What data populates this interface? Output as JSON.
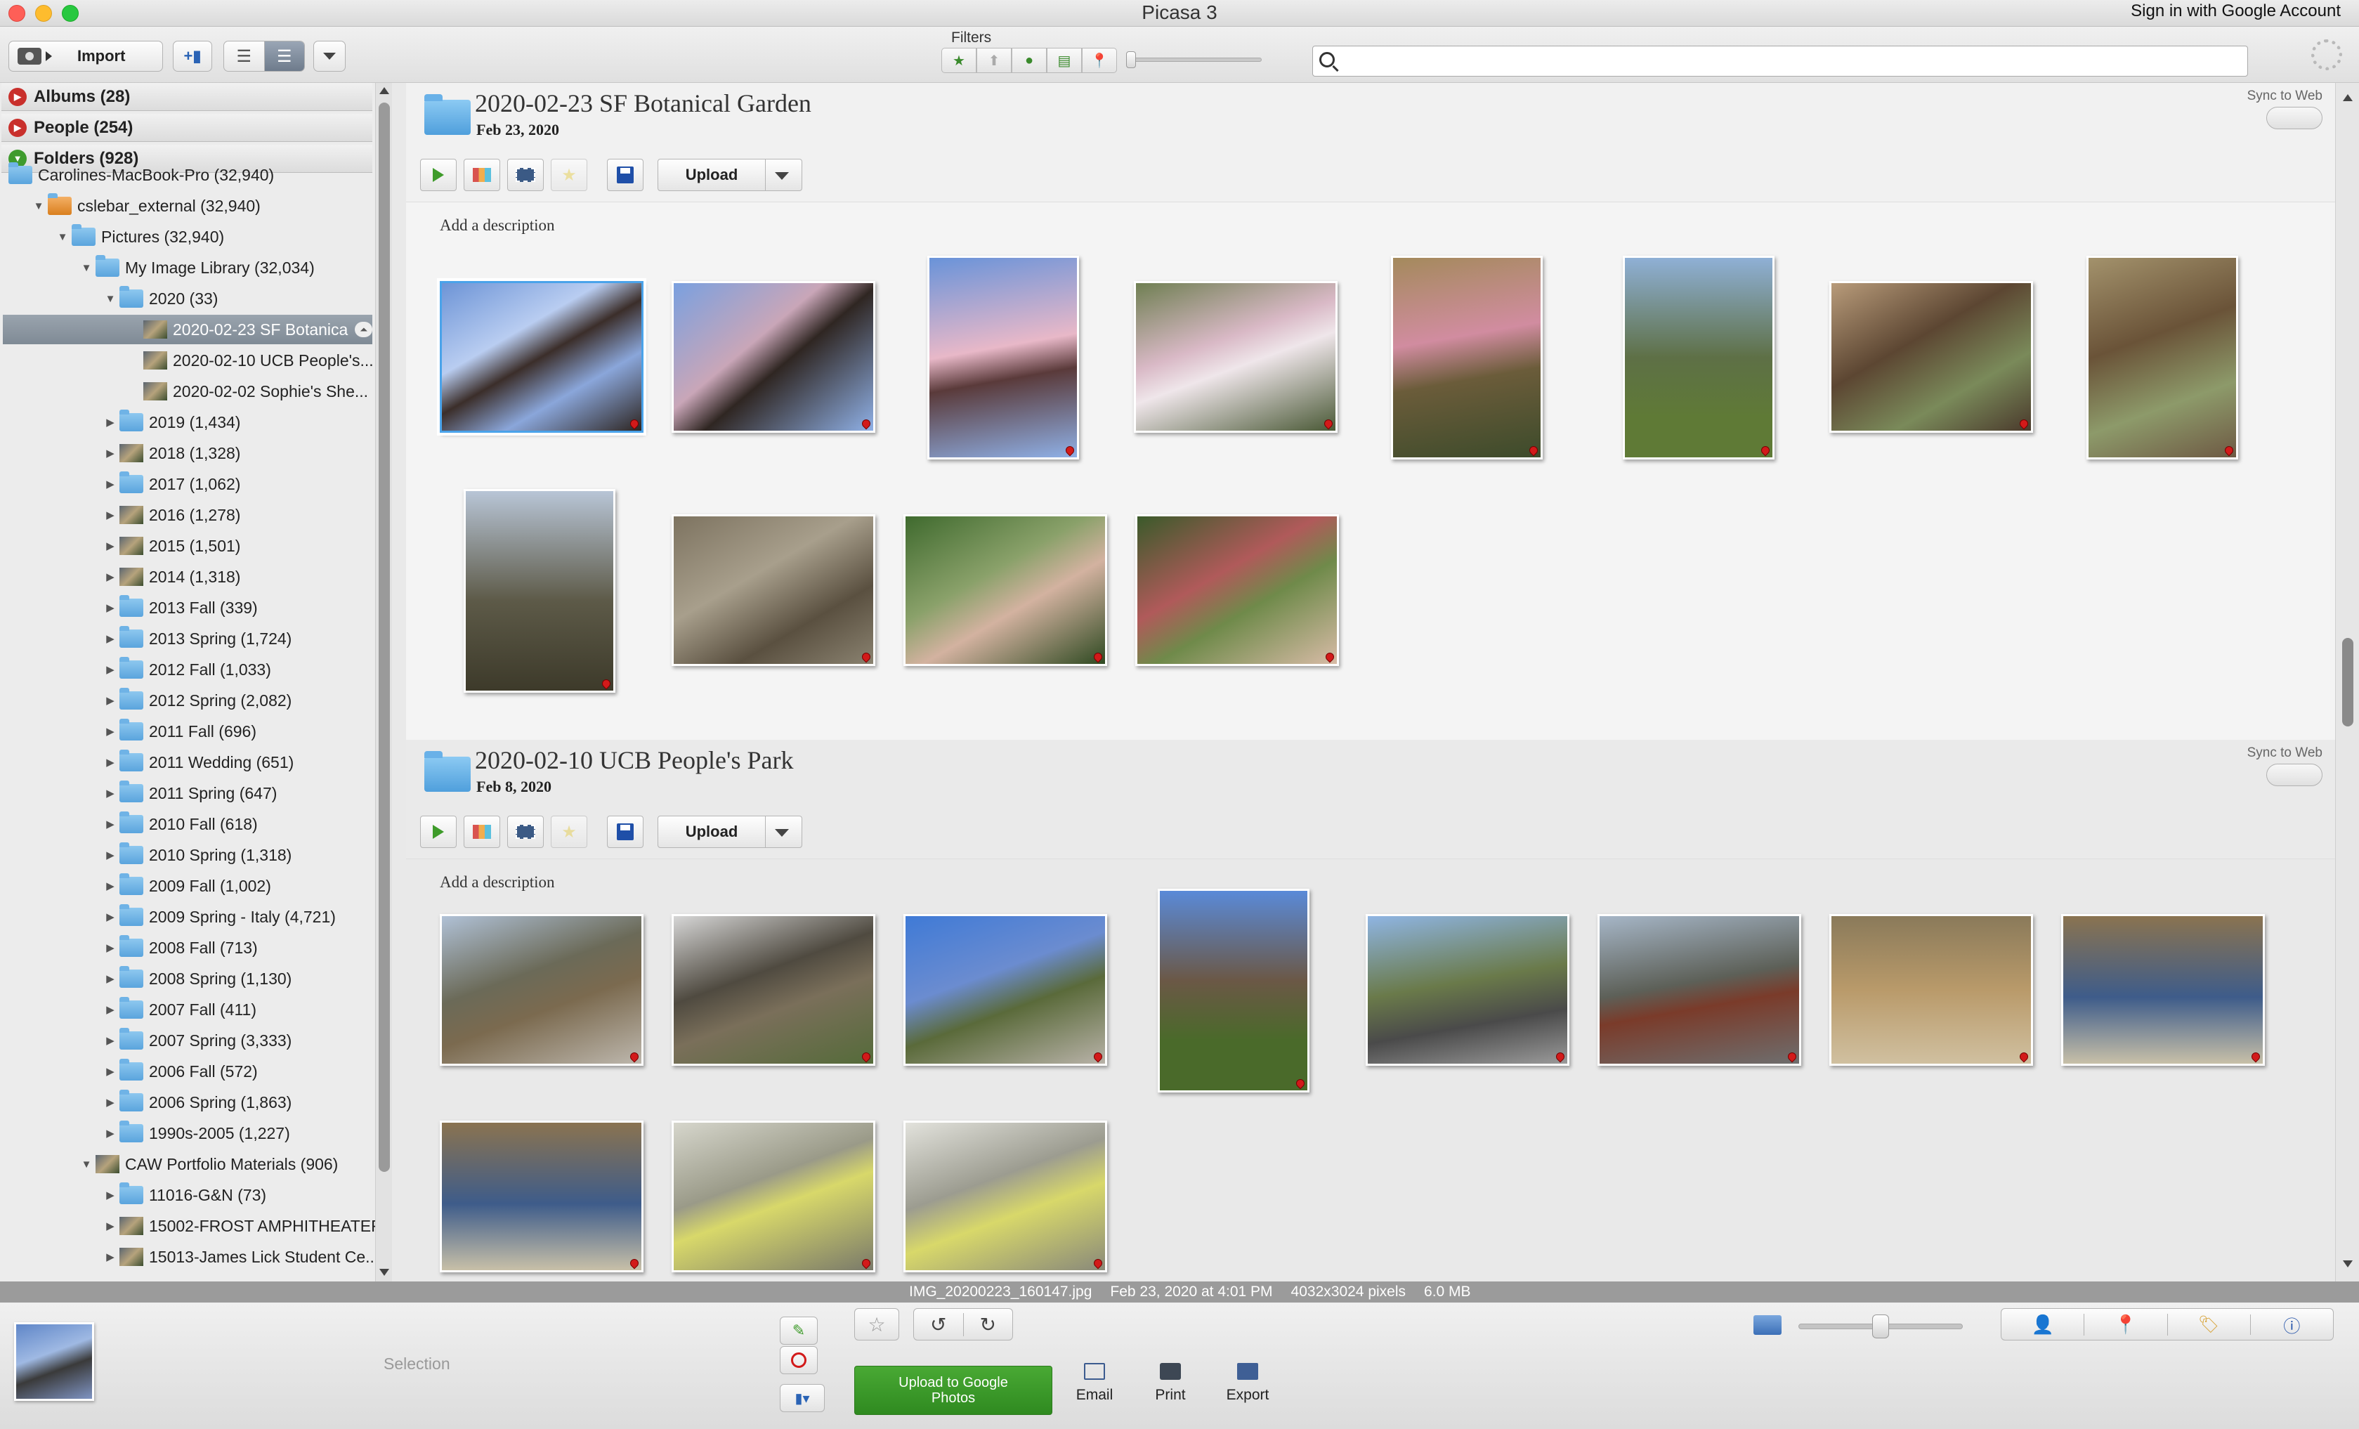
{
  "app": {
    "title": "Picasa 3",
    "signin": "Sign in with Google Account"
  },
  "toolbar": {
    "import_label": "Import",
    "filters_label": "Filters",
    "search_placeholder": ""
  },
  "sidebar": {
    "sections": [
      {
        "label": "Albums (28)",
        "expanded": false
      },
      {
        "label": "People (254)",
        "expanded": false
      },
      {
        "label": "Folders (928)",
        "expanded": true
      }
    ],
    "tree": [
      {
        "label": "Carolines-MacBook-Pro (32,940)",
        "indent": 0,
        "icon": "folder",
        "tri": ""
      },
      {
        "label": "cslebar_external (32,940)",
        "indent": 1,
        "icon": "drive",
        "tri": "down"
      },
      {
        "label": "Pictures (32,940)",
        "indent": 2,
        "icon": "folder",
        "tri": "down"
      },
      {
        "label": "My Image Library (32,034)",
        "indent": 3,
        "icon": "folder",
        "tri": "down"
      },
      {
        "label": "2020 (33)",
        "indent": 4,
        "icon": "folder",
        "tri": "down"
      },
      {
        "label": "2020-02-23 SF Botanica",
        "indent": 5,
        "icon": "thumb",
        "tri": "",
        "selected": true
      },
      {
        "label": "2020-02-10 UCB People's...",
        "indent": 5,
        "icon": "thumb",
        "tri": ""
      },
      {
        "label": "2020-02-02 Sophie's She...",
        "indent": 5,
        "icon": "thumb",
        "tri": ""
      },
      {
        "label": "2019 (1,434)",
        "indent": 4,
        "icon": "folder",
        "tri": "right"
      },
      {
        "label": "2018 (1,328)",
        "indent": 4,
        "icon": "thumb",
        "tri": "right"
      },
      {
        "label": "2017 (1,062)",
        "indent": 4,
        "icon": "folder",
        "tri": "right"
      },
      {
        "label": "2016 (1,278)",
        "indent": 4,
        "icon": "thumb",
        "tri": "right"
      },
      {
        "label": "2015 (1,501)",
        "indent": 4,
        "icon": "thumb",
        "tri": "right"
      },
      {
        "label": "2014 (1,318)",
        "indent": 4,
        "icon": "thumb",
        "tri": "right"
      },
      {
        "label": "2013 Fall (339)",
        "indent": 4,
        "icon": "folder",
        "tri": "right"
      },
      {
        "label": "2013 Spring (1,724)",
        "indent": 4,
        "icon": "folder",
        "tri": "right"
      },
      {
        "label": "2012 Fall (1,033)",
        "indent": 4,
        "icon": "folder",
        "tri": "right"
      },
      {
        "label": "2012 Spring (2,082)",
        "indent": 4,
        "icon": "folder",
        "tri": "right"
      },
      {
        "label": "2011 Fall (696)",
        "indent": 4,
        "icon": "folder",
        "tri": "right"
      },
      {
        "label": "2011 Wedding (651)",
        "indent": 4,
        "icon": "folder",
        "tri": "right"
      },
      {
        "label": "2011 Spring (647)",
        "indent": 4,
        "icon": "folder",
        "tri": "right"
      },
      {
        "label": "2010 Fall (618)",
        "indent": 4,
        "icon": "folder",
        "tri": "right"
      },
      {
        "label": "2010 Spring (1,318)",
        "indent": 4,
        "icon": "folder",
        "tri": "right"
      },
      {
        "label": "2009 Fall (1,002)",
        "indent": 4,
        "icon": "folder",
        "tri": "right"
      },
      {
        "label": "2009 Spring - Italy (4,721)",
        "indent": 4,
        "icon": "folder",
        "tri": "right"
      },
      {
        "label": "2008 Fall (713)",
        "indent": 4,
        "icon": "folder",
        "tri": "right"
      },
      {
        "label": "2008 Spring (1,130)",
        "indent": 4,
        "icon": "folder",
        "tri": "right"
      },
      {
        "label": "2007 Fall (411)",
        "indent": 4,
        "icon": "folder",
        "tri": "right"
      },
      {
        "label": "2007 Spring (3,333)",
        "indent": 4,
        "icon": "folder",
        "tri": "right"
      },
      {
        "label": "2006 Fall (572)",
        "indent": 4,
        "icon": "folder",
        "tri": "right"
      },
      {
        "label": "2006 Spring (1,863)",
        "indent": 4,
        "icon": "folder",
        "tri": "right"
      },
      {
        "label": "1990s-2005 (1,227)",
        "indent": 4,
        "icon": "folder",
        "tri": "right"
      },
      {
        "label": "CAW Portfolio Materials (906)",
        "indent": 3,
        "icon": "thumb",
        "tri": "down"
      },
      {
        "label": "11016-G&N (73)",
        "indent": 4,
        "icon": "folder",
        "tri": "right"
      },
      {
        "label": "15002-FROST AMPHITHEATER...",
        "indent": 4,
        "icon": "thumb",
        "tri": "right"
      },
      {
        "label": "15013-James Lick Student Ce...",
        "indent": 4,
        "icon": "thumb",
        "tri": "right"
      }
    ]
  },
  "albums": [
    {
      "title": "2020-02-23 SF Botanical Garden",
      "date": "Feb 23, 2020",
      "sync_label": "Sync to Web",
      "upload_label": "Upload",
      "description": "Add a description"
    },
    {
      "title": "2020-02-10 UCB People's Park",
      "date": "Feb 8, 2020",
      "sync_label": "Sync to Web",
      "upload_label": "Upload",
      "description": "Add a description"
    }
  ],
  "info": {
    "filename": "IMG_20200223_160147.jpg",
    "datetime": "Feb 23, 2020 at 4:01 PM",
    "dimensions": "4032x3024 pixels",
    "size": "6.0 MB"
  },
  "bottom": {
    "selection_label": "Selection",
    "upload_google": "Upload to Google Photos",
    "email": "Email",
    "print": "Print",
    "export": "Export"
  },
  "colors": {
    "accent_green": "#3e9b2a",
    "folder_blue": "#5aa4dd",
    "selection_blue": "#4aa3ea",
    "pin_red": "#d21a1a"
  }
}
